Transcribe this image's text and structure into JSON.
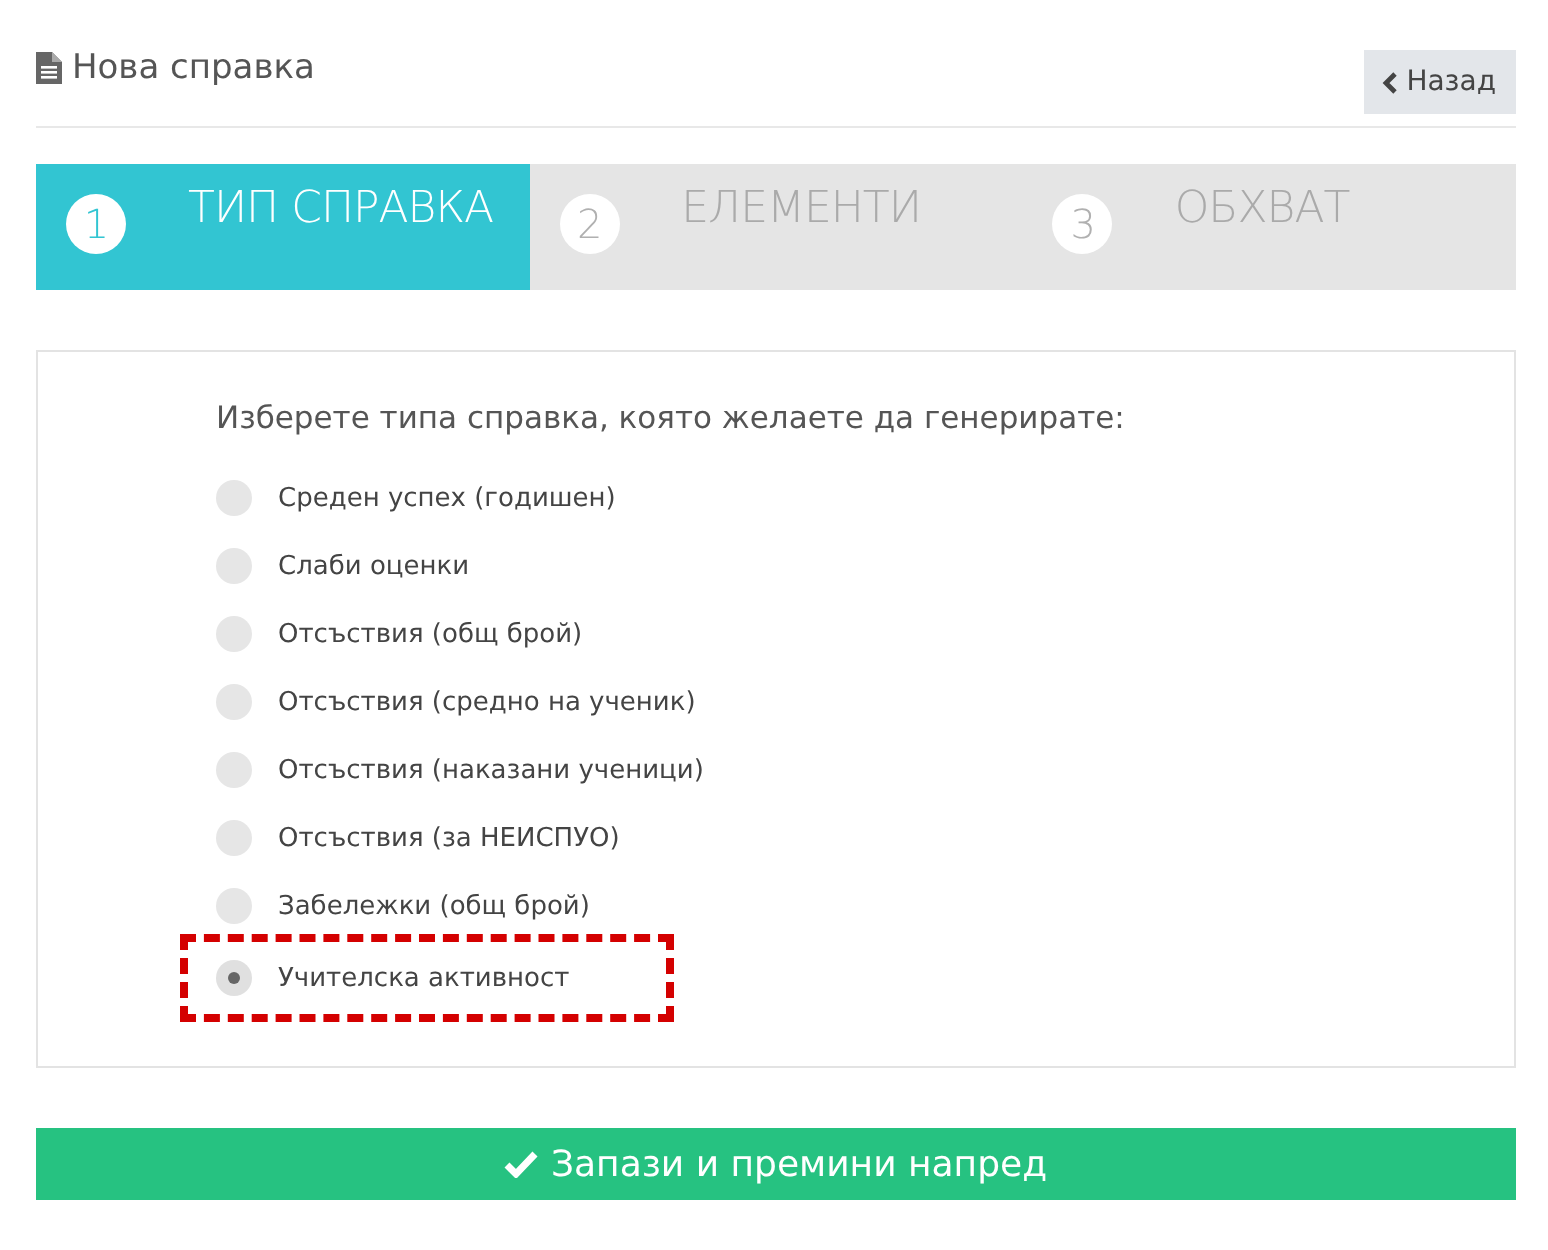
{
  "header": {
    "title": "Нова справка",
    "back_button": "Назад"
  },
  "steps": [
    {
      "number": "1",
      "label": "ТИП СПРАВКА",
      "selected": true
    },
    {
      "number": "2",
      "label": "ЕЛЕМЕНТИ",
      "selected": false
    },
    {
      "number": "3",
      "label": "ОБХВАТ",
      "selected": false
    }
  ],
  "form": {
    "question": "Изберете типа справка, която желаете да генерирате:",
    "options": [
      {
        "label": "Среден успех (годишен)",
        "selected": false,
        "highlighted": false
      },
      {
        "label": "Слаби оценки",
        "selected": false,
        "highlighted": false
      },
      {
        "label": "Отсъствия (общ брой)",
        "selected": false,
        "highlighted": false
      },
      {
        "label": "Отсъствия (средно на ученик)",
        "selected": false,
        "highlighted": false
      },
      {
        "label": "Отсъствия (наказани ученици)",
        "selected": false,
        "highlighted": false
      },
      {
        "label": "Отсъствия (за НЕИСПУО)",
        "selected": false,
        "highlighted": false
      },
      {
        "label": "Забележки (общ брой)",
        "selected": false,
        "highlighted": false
      },
      {
        "label": "Учителска активност",
        "selected": true,
        "highlighted": true
      }
    ]
  },
  "submit_button": "Запази и премини напред"
}
